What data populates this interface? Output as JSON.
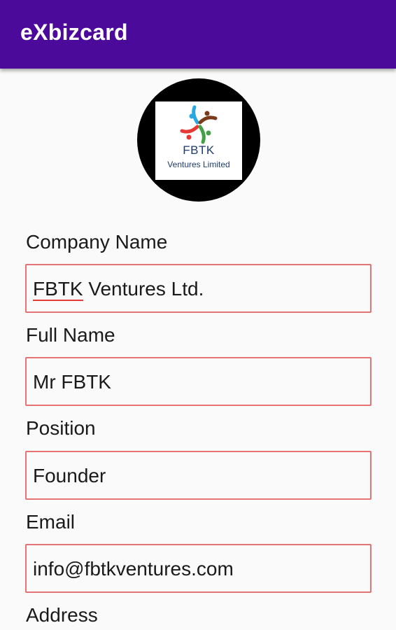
{
  "app_bar": {
    "title": "eXbizcard"
  },
  "logo": {
    "line1": "FBTK",
    "line2": "Ventures Limited",
    "colors": {
      "circle": "#000000",
      "figure_blue": "#29a8e0",
      "figure_brown": "#7a3b1a",
      "figure_red": "#e53935",
      "figure_green": "#43a047",
      "text": "#1f3b6e"
    }
  },
  "form": {
    "company": {
      "label": "Company Name",
      "value_flagged": "FBTK",
      "value_rest": " Ventures Ltd."
    },
    "full_name": {
      "label": "Full Name",
      "value": "Mr FBTK"
    },
    "position": {
      "label": "Position",
      "value": "Founder"
    },
    "email": {
      "label": "Email",
      "value": "info@fbtkventures.com"
    },
    "address": {
      "label": "Address"
    }
  },
  "theme": {
    "primary": "#4b0a9a",
    "field_border": "#e57373",
    "spellcheck_underline": "#e53935"
  }
}
